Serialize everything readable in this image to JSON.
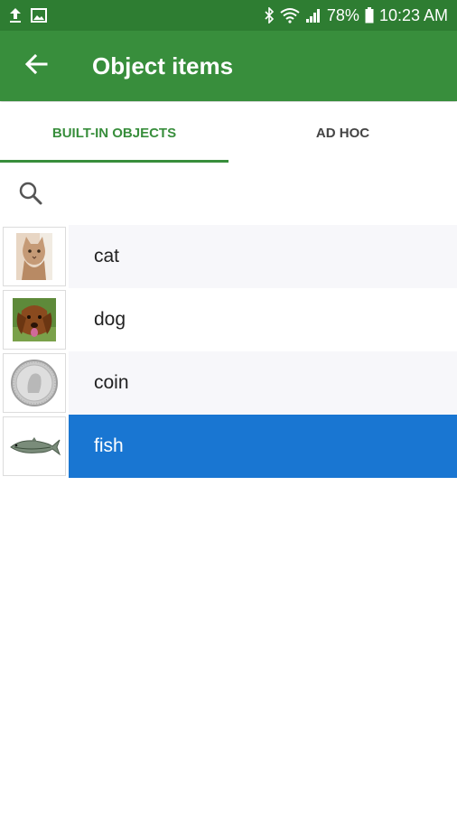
{
  "status_bar": {
    "battery": "78%",
    "time": "10:23 AM",
    "icons": [
      "upload-icon",
      "image-icon",
      "bluetooth-icon",
      "wifi-icon",
      "signal-icon",
      "battery-icon"
    ]
  },
  "app_bar": {
    "title": "Object items",
    "back_icon": "arrow-back-icon",
    "color": "#388e3c"
  },
  "tabs": [
    {
      "label": "BUILT-IN OBJECTS",
      "active": true
    },
    {
      "label": "AD HOC",
      "active": false
    }
  ],
  "search": {
    "icon": "search-icon"
  },
  "items": [
    {
      "label": "cat",
      "thumb": "cat-thumbnail"
    },
    {
      "label": "dog",
      "thumb": "dog-thumbnail"
    },
    {
      "label": "coin",
      "thumb": "coin-thumbnail"
    },
    {
      "label": "fish",
      "thumb": "fish-thumbnail",
      "selected": true
    }
  ],
  "colors": {
    "accent_green": "#388e3c",
    "status_green": "#2e7d32",
    "selected_blue": "#1976d2"
  }
}
